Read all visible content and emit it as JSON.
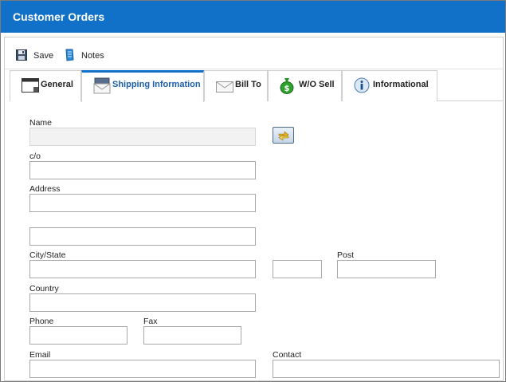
{
  "window": {
    "title": "Customer Orders"
  },
  "toolbar": {
    "save_label": "Save",
    "notes_label": "Notes"
  },
  "tabs": [
    {
      "label": "General",
      "icon": "window-icon"
    },
    {
      "label": "Shipping Information",
      "icon": "shipping-envelope-icon"
    },
    {
      "label": "Bill To",
      "icon": "envelope-icon"
    },
    {
      "label": "W/O Sell",
      "icon": "money-bag-icon"
    },
    {
      "label": "Informational",
      "icon": "info-icon"
    }
  ],
  "active_tab": "Shipping Information",
  "form": {
    "name_label": "Name",
    "co_label": "c/o",
    "address_label": "Address",
    "city_state_label": "City/State",
    "post_label": "Post",
    "country_label": "Country",
    "phone_label": "Phone",
    "fax_label": "Fax",
    "email_label": "Email",
    "contact_label": "Contact",
    "lookup_icon": "arrow-swap-icon"
  },
  "colors": {
    "titlebar": "#1170c8",
    "active_tab_accent": "#1170c8",
    "active_tab_text": "#1a5fa8"
  }
}
